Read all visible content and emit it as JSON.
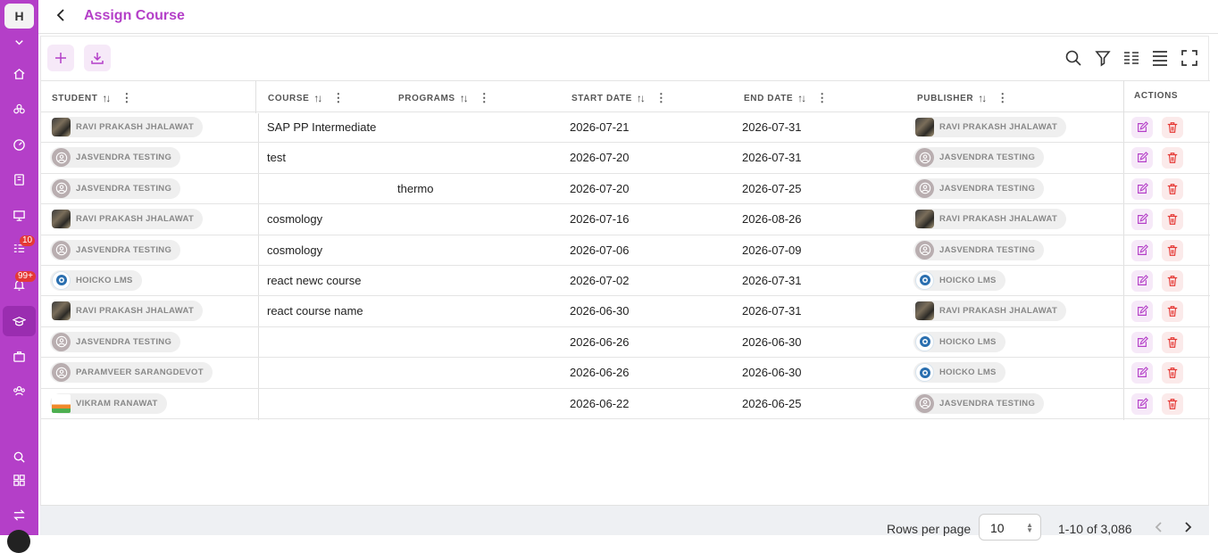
{
  "app": {
    "logo_letter": "H"
  },
  "sidebar": {
    "badges": {
      "tasks": "10",
      "notifications": "99+"
    },
    "icons": [
      "chevron-down-icon",
      "home-icon",
      "group-icon",
      "gauge-icon",
      "book-icon",
      "presentation-icon",
      "tasks-icon",
      "bell-icon",
      "graduation-cap-icon",
      "briefcase-icon",
      "users-icon",
      "search-icon",
      "apps-icon",
      "swap-icon"
    ]
  },
  "header": {
    "title": "Assign Course"
  },
  "table": {
    "columns": {
      "student": "STUDENT",
      "course": "COURSE",
      "programs": "PROGRAMS",
      "start_date": "START DATE",
      "end_date": "END DATE",
      "publisher": "PUBLISHER",
      "actions": "ACTIONS"
    },
    "rows": [
      {
        "student": "RAVI PRAKASH JHALAWAT",
        "student_avatar": "photo",
        "course": "SAP PP Intermediate",
        "program": "",
        "start": "2026-07-21",
        "end": "2026-07-31",
        "publisher": "RAVI PRAKASH JHALAWAT",
        "publisher_avatar": "photo"
      },
      {
        "student": "JASVENDRA TESTING",
        "student_avatar": "default",
        "course": "test",
        "program": "",
        "start": "2026-07-20",
        "end": "2026-07-31",
        "publisher": "JASVENDRA TESTING",
        "publisher_avatar": "default"
      },
      {
        "student": "JASVENDRA TESTING",
        "student_avatar": "default",
        "course": "",
        "program": "thermo",
        "start": "2026-07-20",
        "end": "2026-07-25",
        "publisher": "JASVENDRA TESTING",
        "publisher_avatar": "default"
      },
      {
        "student": "RAVI PRAKASH JHALAWAT",
        "student_avatar": "photo",
        "course": "cosmology",
        "program": "",
        "start": "2026-07-16",
        "end": "2026-08-26",
        "publisher": "RAVI PRAKASH JHALAWAT",
        "publisher_avatar": "photo"
      },
      {
        "student": "JASVENDRA TESTING",
        "student_avatar": "default",
        "course": "cosmology",
        "program": "",
        "start": "2026-07-06",
        "end": "2026-07-09",
        "publisher": "JASVENDRA TESTING",
        "publisher_avatar": "default"
      },
      {
        "student": "HOICKO LMS",
        "student_avatar": "lms",
        "course": "react newc course",
        "program": "",
        "start": "2026-07-02",
        "end": "2026-07-31",
        "publisher": "HOICKO LMS",
        "publisher_avatar": "lms"
      },
      {
        "student": "RAVI PRAKASH JHALAWAT",
        "student_avatar": "photo",
        "course": "react course name",
        "program": "",
        "start": "2026-06-30",
        "end": "2026-07-31",
        "publisher": "RAVI PRAKASH JHALAWAT",
        "publisher_avatar": "photo"
      },
      {
        "student": "JASVENDRA TESTING",
        "student_avatar": "default",
        "course": "",
        "program": "",
        "start": "2026-06-26",
        "end": "2026-06-30",
        "publisher": "HOICKO LMS",
        "publisher_avatar": "lms"
      },
      {
        "student": "PARAMVEER SARANGDEVOT",
        "student_avatar": "default",
        "course": "",
        "program": "",
        "start": "2026-06-26",
        "end": "2026-06-30",
        "publisher": "HOICKO LMS",
        "publisher_avatar": "lms"
      },
      {
        "student": "VIKRAM RANAWAT",
        "student_avatar": "flag",
        "course": "",
        "program": "",
        "start": "2026-06-22",
        "end": "2026-06-25",
        "publisher": "JASVENDRA TESTING",
        "publisher_avatar": "default"
      }
    ]
  },
  "pagination": {
    "rows_per_page_label": "Rows per page",
    "rows_per_page": "10",
    "range": "1-10 of 3,086"
  },
  "colors": {
    "accent": "#b43fc8",
    "delete": "#e53935"
  }
}
